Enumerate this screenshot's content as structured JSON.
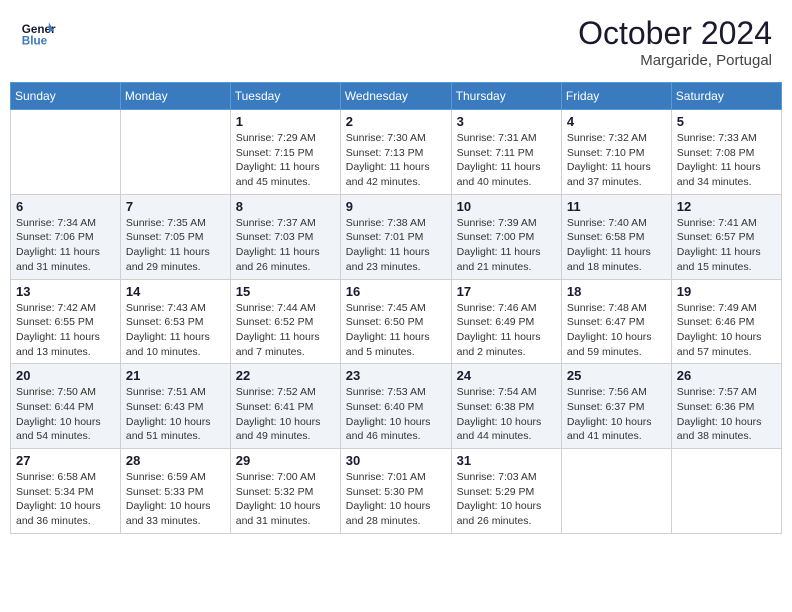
{
  "header": {
    "logo_line1": "General",
    "logo_line2": "Blue",
    "month_title": "October 2024",
    "location": "Margaride, Portugal"
  },
  "weekdays": [
    "Sunday",
    "Monday",
    "Tuesday",
    "Wednesday",
    "Thursday",
    "Friday",
    "Saturday"
  ],
  "weeks": [
    [
      {
        "day": "",
        "info": ""
      },
      {
        "day": "",
        "info": ""
      },
      {
        "day": "1",
        "info": "Sunrise: 7:29 AM\nSunset: 7:15 PM\nDaylight: 11 hours and 45 minutes."
      },
      {
        "day": "2",
        "info": "Sunrise: 7:30 AM\nSunset: 7:13 PM\nDaylight: 11 hours and 42 minutes."
      },
      {
        "day": "3",
        "info": "Sunrise: 7:31 AM\nSunset: 7:11 PM\nDaylight: 11 hours and 40 minutes."
      },
      {
        "day": "4",
        "info": "Sunrise: 7:32 AM\nSunset: 7:10 PM\nDaylight: 11 hours and 37 minutes."
      },
      {
        "day": "5",
        "info": "Sunrise: 7:33 AM\nSunset: 7:08 PM\nDaylight: 11 hours and 34 minutes."
      }
    ],
    [
      {
        "day": "6",
        "info": "Sunrise: 7:34 AM\nSunset: 7:06 PM\nDaylight: 11 hours and 31 minutes."
      },
      {
        "day": "7",
        "info": "Sunrise: 7:35 AM\nSunset: 7:05 PM\nDaylight: 11 hours and 29 minutes."
      },
      {
        "day": "8",
        "info": "Sunrise: 7:37 AM\nSunset: 7:03 PM\nDaylight: 11 hours and 26 minutes."
      },
      {
        "day": "9",
        "info": "Sunrise: 7:38 AM\nSunset: 7:01 PM\nDaylight: 11 hours and 23 minutes."
      },
      {
        "day": "10",
        "info": "Sunrise: 7:39 AM\nSunset: 7:00 PM\nDaylight: 11 hours and 21 minutes."
      },
      {
        "day": "11",
        "info": "Sunrise: 7:40 AM\nSunset: 6:58 PM\nDaylight: 11 hours and 18 minutes."
      },
      {
        "day": "12",
        "info": "Sunrise: 7:41 AM\nSunset: 6:57 PM\nDaylight: 11 hours and 15 minutes."
      }
    ],
    [
      {
        "day": "13",
        "info": "Sunrise: 7:42 AM\nSunset: 6:55 PM\nDaylight: 11 hours and 13 minutes."
      },
      {
        "day": "14",
        "info": "Sunrise: 7:43 AM\nSunset: 6:53 PM\nDaylight: 11 hours and 10 minutes."
      },
      {
        "day": "15",
        "info": "Sunrise: 7:44 AM\nSunset: 6:52 PM\nDaylight: 11 hours and 7 minutes."
      },
      {
        "day": "16",
        "info": "Sunrise: 7:45 AM\nSunset: 6:50 PM\nDaylight: 11 hours and 5 minutes."
      },
      {
        "day": "17",
        "info": "Sunrise: 7:46 AM\nSunset: 6:49 PM\nDaylight: 11 hours and 2 minutes."
      },
      {
        "day": "18",
        "info": "Sunrise: 7:48 AM\nSunset: 6:47 PM\nDaylight: 10 hours and 59 minutes."
      },
      {
        "day": "19",
        "info": "Sunrise: 7:49 AM\nSunset: 6:46 PM\nDaylight: 10 hours and 57 minutes."
      }
    ],
    [
      {
        "day": "20",
        "info": "Sunrise: 7:50 AM\nSunset: 6:44 PM\nDaylight: 10 hours and 54 minutes."
      },
      {
        "day": "21",
        "info": "Sunrise: 7:51 AM\nSunset: 6:43 PM\nDaylight: 10 hours and 51 minutes."
      },
      {
        "day": "22",
        "info": "Sunrise: 7:52 AM\nSunset: 6:41 PM\nDaylight: 10 hours and 49 minutes."
      },
      {
        "day": "23",
        "info": "Sunrise: 7:53 AM\nSunset: 6:40 PM\nDaylight: 10 hours and 46 minutes."
      },
      {
        "day": "24",
        "info": "Sunrise: 7:54 AM\nSunset: 6:38 PM\nDaylight: 10 hours and 44 minutes."
      },
      {
        "day": "25",
        "info": "Sunrise: 7:56 AM\nSunset: 6:37 PM\nDaylight: 10 hours and 41 minutes."
      },
      {
        "day": "26",
        "info": "Sunrise: 7:57 AM\nSunset: 6:36 PM\nDaylight: 10 hours and 38 minutes."
      }
    ],
    [
      {
        "day": "27",
        "info": "Sunrise: 6:58 AM\nSunset: 5:34 PM\nDaylight: 10 hours and 36 minutes."
      },
      {
        "day": "28",
        "info": "Sunrise: 6:59 AM\nSunset: 5:33 PM\nDaylight: 10 hours and 33 minutes."
      },
      {
        "day": "29",
        "info": "Sunrise: 7:00 AM\nSunset: 5:32 PM\nDaylight: 10 hours and 31 minutes."
      },
      {
        "day": "30",
        "info": "Sunrise: 7:01 AM\nSunset: 5:30 PM\nDaylight: 10 hours and 28 minutes."
      },
      {
        "day": "31",
        "info": "Sunrise: 7:03 AM\nSunset: 5:29 PM\nDaylight: 10 hours and 26 minutes."
      },
      {
        "day": "",
        "info": ""
      },
      {
        "day": "",
        "info": ""
      }
    ]
  ]
}
